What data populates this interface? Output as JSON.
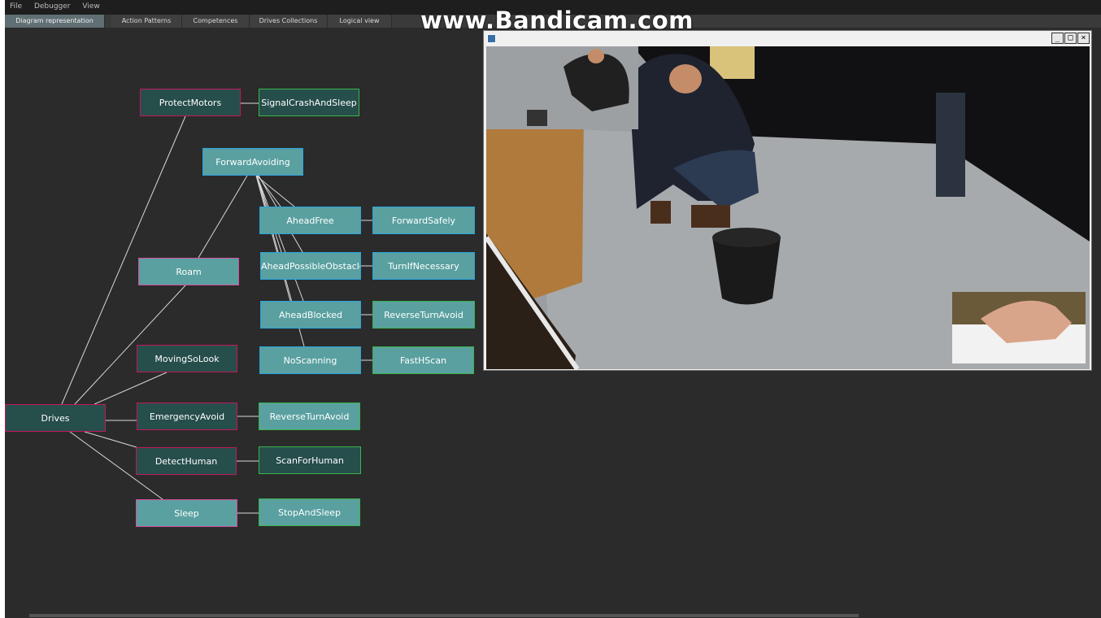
{
  "menu": [
    "File",
    "Debugger",
    "View"
  ],
  "tabs": [
    "Diagram representation",
    "Action Patterns",
    "Competences",
    "Drives Collections",
    "Logical view"
  ],
  "watermark": "www.Bandicam.com",
  "diagram": {
    "root": "Drives",
    "drives": [
      "ProtectMotors",
      "Roam",
      "MovingSoLook",
      "EmergencyAvoid",
      "DetectHuman",
      "Sleep"
    ],
    "competence": "ForwardAvoiding",
    "competence_elements": [
      "AheadFree",
      "AheadPossibleObstacle",
      "AheadBlocked",
      "NoScanning"
    ],
    "actions": {
      "protect_motors": "SignalCrashAndSleep",
      "ahead_free": "ForwardSafely",
      "ahead_possible_obstacle": "TurnIfNecessary",
      "ahead_blocked": "ReverseTurnAvoid",
      "no_scanning": "FastHScan",
      "emergency_avoid": "ReverseTurnAvoid",
      "detect_human": "ScanForHuman",
      "sleep": "StopAndSleep"
    }
  },
  "video_window": {
    "controls": [
      "_",
      "□",
      "×"
    ]
  }
}
